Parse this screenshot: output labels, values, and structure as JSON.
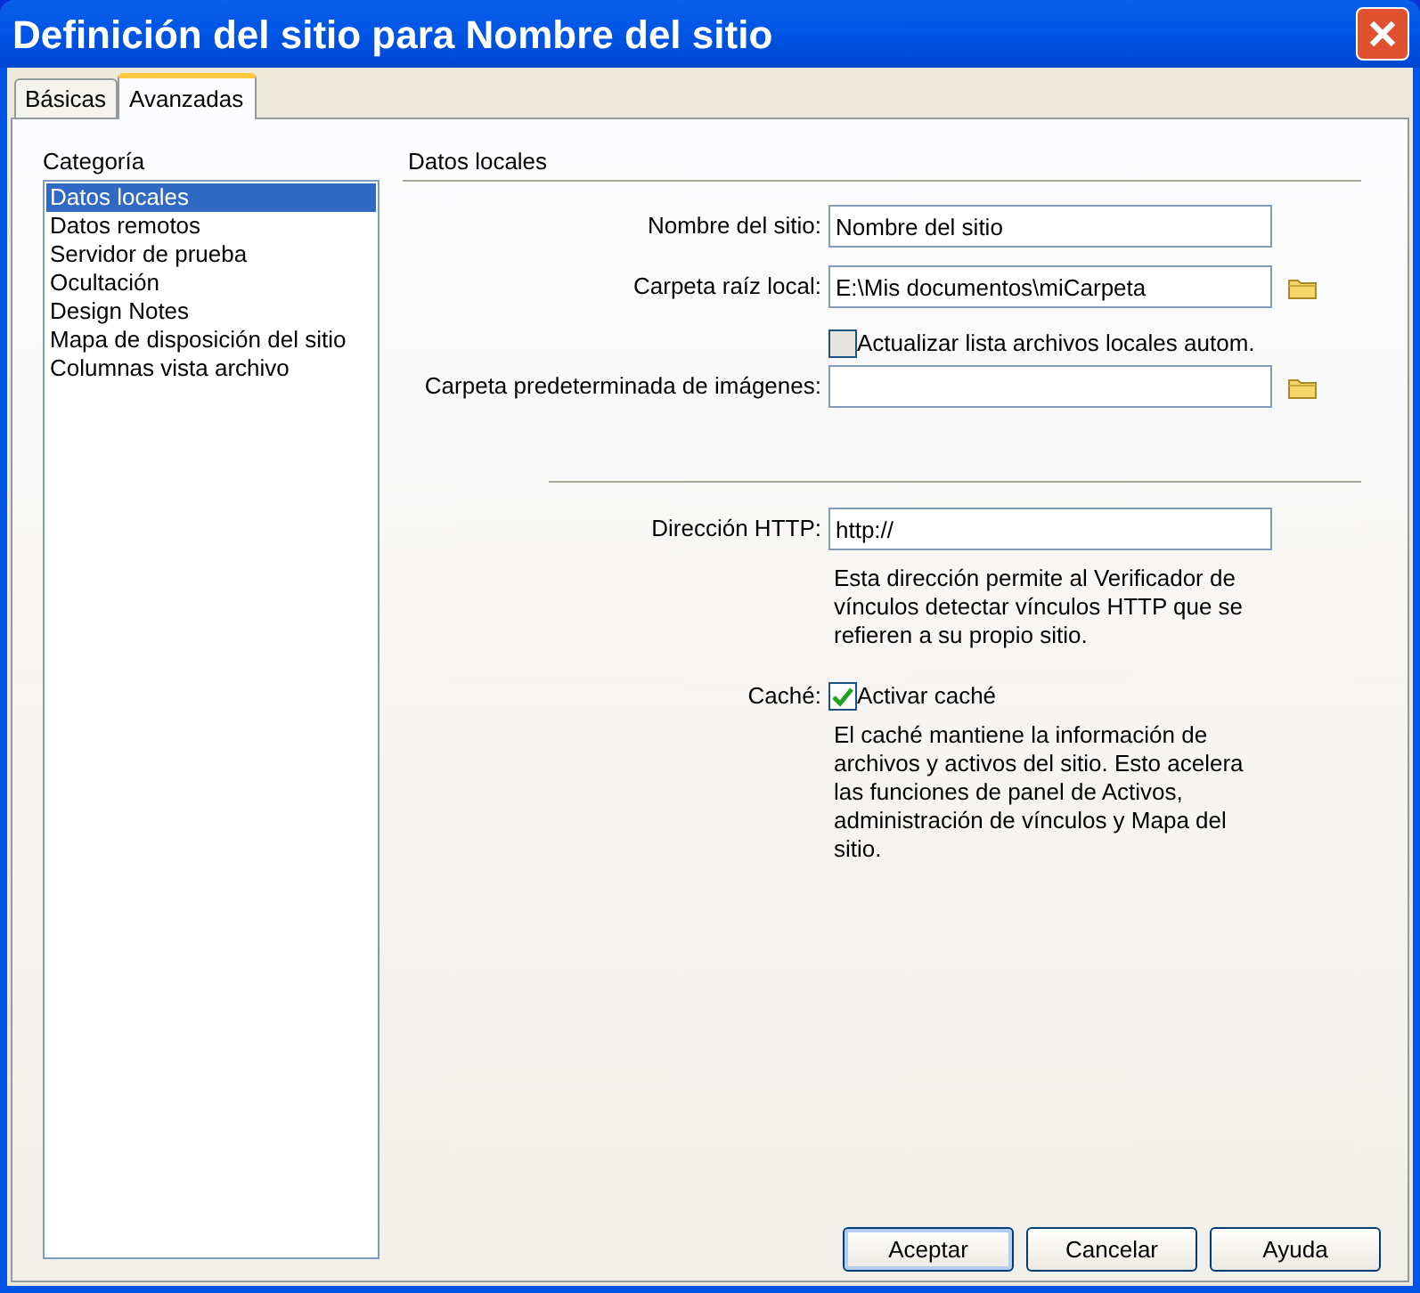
{
  "window": {
    "title": "Definición del sitio para Nombre del sitio"
  },
  "tabs": [
    {
      "label": "Básicas",
      "selected": false
    },
    {
      "label": "Avanzadas",
      "selected": true
    }
  ],
  "sidebar": {
    "label": "Categoría",
    "items": [
      {
        "label": "Datos locales",
        "selected": true
      },
      {
        "label": "Datos remotos",
        "selected": false
      },
      {
        "label": "Servidor de prueba",
        "selected": false
      },
      {
        "label": "Ocultación",
        "selected": false
      },
      {
        "label": "Design Notes",
        "selected": false
      },
      {
        "label": "Mapa de disposición del sitio",
        "selected": false
      },
      {
        "label": "Columnas vista archivo",
        "selected": false
      }
    ]
  },
  "panel": {
    "title": "Datos locales",
    "rows": [
      {
        "kind": "text",
        "label": "Nombre del sitio:",
        "value": "Nombre del sitio",
        "browse": false
      },
      {
        "kind": "text",
        "label": "Carpeta raíz local:",
        "value": "E:\\Mis documentos\\miCarpeta",
        "browse": true
      },
      {
        "kind": "checkbox",
        "text": "Actualizar lista archivos locales autom.",
        "checked": false
      },
      {
        "kind": "text",
        "label": "Carpeta predeterminada de imágenes:",
        "browse": true
      },
      {
        "kind": "separator"
      },
      {
        "kind": "text",
        "label": "Dirección HTTP:",
        "value": "http://",
        "browse": false
      },
      {
        "kind": "note",
        "text": "Esta dirección permite al Verificador de vínculos detectar vínculos HTTP que se refieren a su propio sitio."
      },
      {
        "kind": "checkbox",
        "label": "Caché:",
        "text": "Activar caché",
        "checked": true
      },
      {
        "kind": "note",
        "text": "El caché mantiene la información de archivos y activos del sitio. Esto acelera las funciones de panel de Activos, administración de vínculos y Mapa del sitio."
      }
    ]
  },
  "buttons": [
    "Aceptar",
    "Cancelar",
    "Ayuda"
  ]
}
